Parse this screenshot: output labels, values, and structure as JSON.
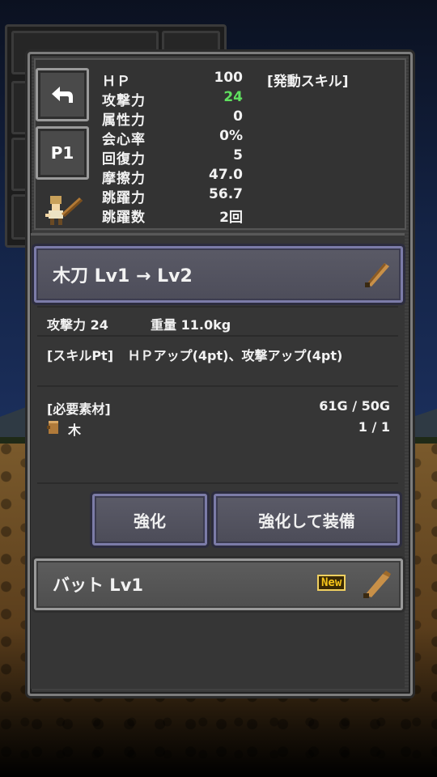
{
  "stats": {
    "rows": [
      {
        "label": "ＨＰ",
        "value": "100"
      },
      {
        "label": "攻撃力",
        "value": "24"
      },
      {
        "label": "属性力",
        "value": "0"
      },
      {
        "label": "会心率",
        "value": "0%"
      },
      {
        "label": "回復力",
        "value": "5"
      },
      {
        "label": "摩擦力",
        "value": "47.0"
      },
      {
        "label": "跳躍力",
        "value": "56.7"
      },
      {
        "label": "跳躍数",
        "value": "2回"
      }
    ],
    "skill_title": "[発動スキル]",
    "highlight_color": "#5fe05f"
  },
  "buttons": {
    "back_icon": "back-arrow-icon",
    "page_label": "P1"
  },
  "item": {
    "name": "木刀 Lv1 → Lv2",
    "attack_label": "攻撃力",
    "attack_value": "24",
    "weight_label": "重量",
    "weight_value": "11.0kg",
    "skillpt_label": "[スキルPt]",
    "skillpt_value": "ＨＰアップ(4pt)、攻撃アップ(4pt)",
    "materials_label": "[必要素材]",
    "gold": "61G / 50G",
    "material_name": "木",
    "material_count": "1 / 1"
  },
  "actions": {
    "upgrade": "強化",
    "upgrade_equip": "強化して装備"
  },
  "next_item": {
    "name": "バット Lv1",
    "badge": "New"
  },
  "colors": {
    "accent_border": "#7c7ca8",
    "panel": "#3a3a3a"
  }
}
